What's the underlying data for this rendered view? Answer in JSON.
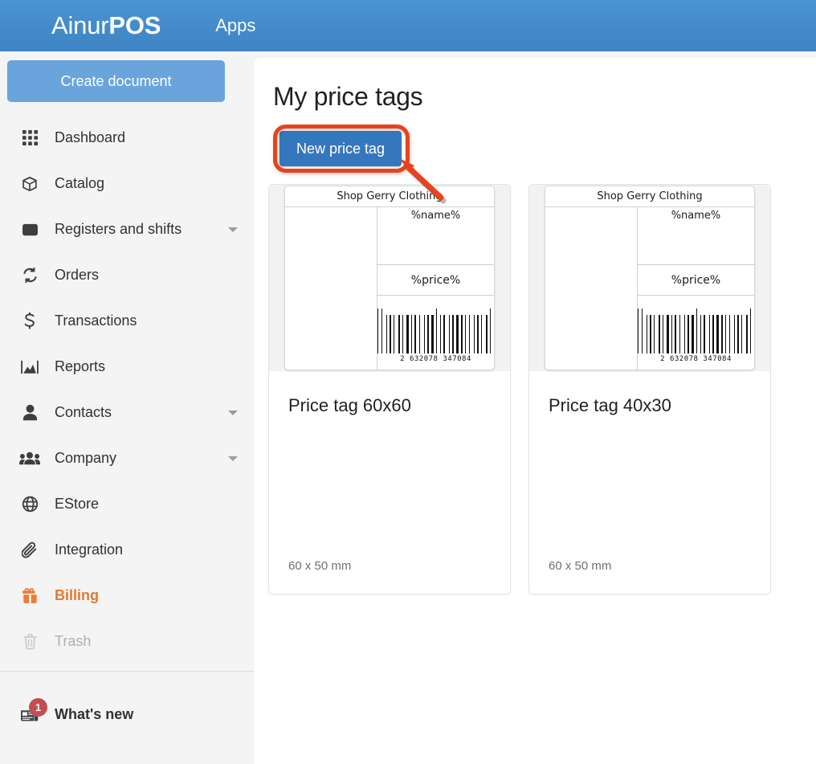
{
  "header": {
    "brand_light": "Ainur",
    "brand_bold": "POS",
    "apps_label": "Apps"
  },
  "sidebar": {
    "create_document_label": "Create document",
    "items": [
      {
        "label": "Dashboard",
        "icon": "grid-icon",
        "caret": false,
        "state": "default"
      },
      {
        "label": "Catalog",
        "icon": "box-icon",
        "caret": false,
        "state": "default"
      },
      {
        "label": "Registers and shifts",
        "icon": "inbox-icon",
        "caret": true,
        "state": "default"
      },
      {
        "label": "Orders",
        "icon": "refresh-icon",
        "caret": false,
        "state": "default"
      },
      {
        "label": "Transactions",
        "icon": "dollar-icon",
        "caret": false,
        "state": "default"
      },
      {
        "label": "Reports",
        "icon": "chart-icon",
        "caret": false,
        "state": "default"
      },
      {
        "label": "Contacts",
        "icon": "person-icon",
        "caret": true,
        "state": "default"
      },
      {
        "label": "Company",
        "icon": "people-icon",
        "caret": true,
        "state": "default"
      },
      {
        "label": "EStore",
        "icon": "globe-icon",
        "caret": false,
        "state": "default"
      },
      {
        "label": "Integration",
        "icon": "paperclip-icon",
        "caret": false,
        "state": "default"
      },
      {
        "label": "Billing",
        "icon": "gift-icon",
        "caret": false,
        "state": "highlighted"
      },
      {
        "label": "Trash",
        "icon": "trash-icon",
        "caret": false,
        "state": "disabled"
      }
    ],
    "whats_new": {
      "label": "What's new",
      "icon": "newspaper-icon",
      "badge_count": "1"
    }
  },
  "main": {
    "page_title": "My price tags",
    "new_price_tag_label": "New price tag",
    "annotation": {
      "type": "highlight-ring-with-arrow",
      "target": "new-price-tag-button",
      "color": "#e8431d"
    },
    "cards": [
      {
        "title": "Price tag 60x60",
        "size": "60 x 50 mm",
        "preview": {
          "shop_name": "Shop Gerry Clothing",
          "name_placeholder": "%name%",
          "price_placeholder": "%price%",
          "barcode_digits": "2  632078  347084"
        }
      },
      {
        "title": "Price tag 40x30",
        "size": "60 x 50 mm",
        "preview": {
          "shop_name": "Shop Gerry Clothing",
          "name_placeholder": "%name%",
          "price_placeholder": "%price%",
          "barcode_digits": "2  632078  347084"
        }
      }
    ]
  },
  "colors": {
    "header_blue": "#3f84c4",
    "primary_blue": "#3577bd",
    "create_blue": "#6aa4dc",
    "annotation_red": "#e8431d",
    "billing_orange": "#e07a32",
    "badge_red": "#c34d53"
  }
}
